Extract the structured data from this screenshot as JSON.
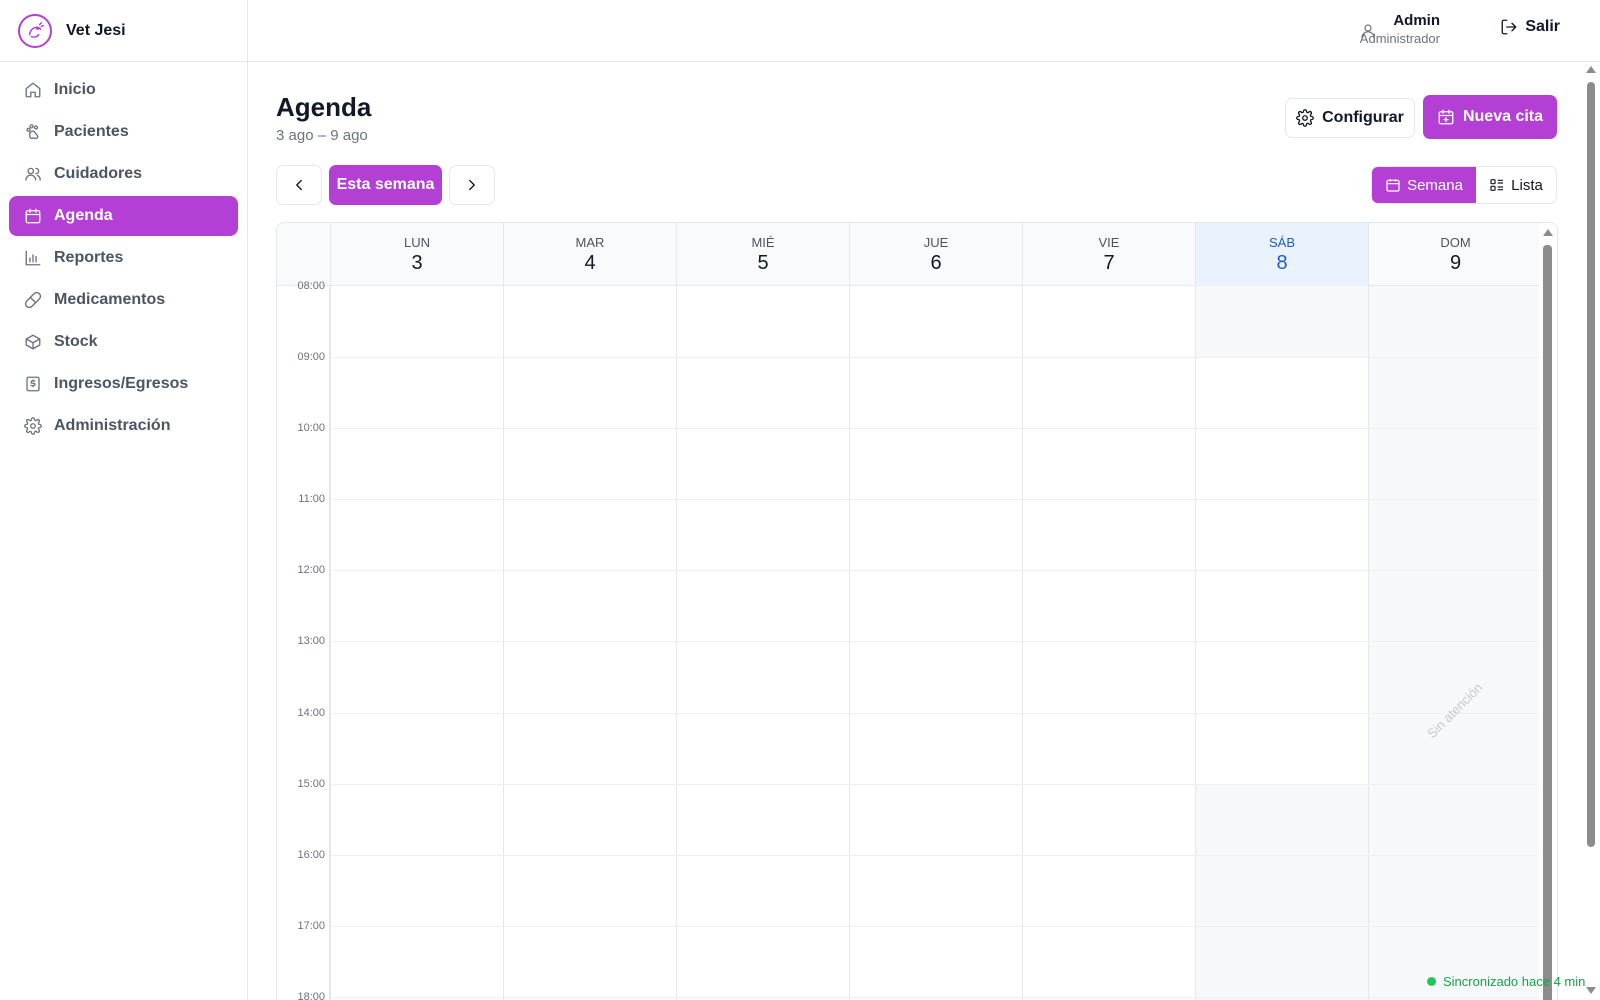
{
  "brand": {
    "name": "Vet Jesi"
  },
  "nav": [
    {
      "label": "Inicio",
      "icon": "home-icon"
    },
    {
      "label": "Pacientes",
      "icon": "paw-icon"
    },
    {
      "label": "Cuidadores",
      "icon": "users-icon"
    },
    {
      "label": "Agenda",
      "icon": "calendar-icon",
      "active": true
    },
    {
      "label": "Reportes",
      "icon": "bar-chart-icon"
    },
    {
      "label": "Medicamentos",
      "icon": "pill-icon"
    },
    {
      "label": "Stock",
      "icon": "box-icon"
    },
    {
      "label": "Ingresos/Egresos",
      "icon": "receipt-icon"
    },
    {
      "label": "Administración",
      "icon": "gear-icon"
    }
  ],
  "user": {
    "name": "Admin",
    "role": "Administrador",
    "logout_label": "Salir"
  },
  "page": {
    "title": "Agenda",
    "range": "3 ago – 9 ago",
    "configure_label": "Configurar",
    "new_appointment_label": "Nueva cita",
    "this_week_label": "Esta semana",
    "views": {
      "week": "Semana",
      "list": "Lista",
      "active": "week"
    }
  },
  "calendar": {
    "days": [
      {
        "name": "LUN",
        "num": "3"
      },
      {
        "name": "MAR",
        "num": "4"
      },
      {
        "name": "MIÉ",
        "num": "5"
      },
      {
        "name": "JUE",
        "num": "6"
      },
      {
        "name": "VIE",
        "num": "7"
      },
      {
        "name": "SÁB",
        "num": "8",
        "today": true
      },
      {
        "name": "DOM",
        "num": "9"
      }
    ],
    "hours": [
      "08:00",
      "09:00",
      "10:00",
      "11:00",
      "12:00",
      "13:00",
      "14:00",
      "15:00",
      "16:00",
      "17:00",
      "18:00"
    ],
    "closed_label": "Sin atención"
  },
  "sync": {
    "text": "Sincronizado hace 4 min"
  },
  "colors": {
    "accent": "#b43fd4",
    "today": "#1d5cc9",
    "sync": "#16a34a"
  }
}
